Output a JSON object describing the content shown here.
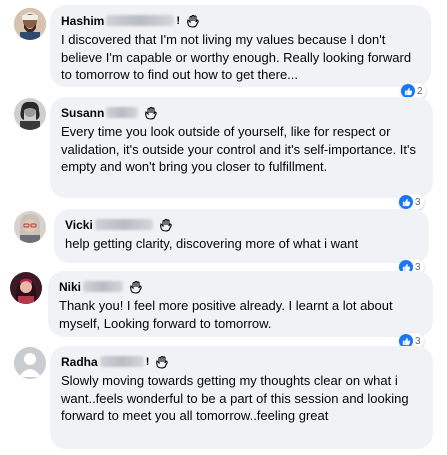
{
  "comments": [
    {
      "name": "Hashim",
      "text": "I discovered that I'm not living my values because I don't believe I'm capable or worthy enough. Really looking forward to tomorrow to find out how to get there...",
      "reactions": "2",
      "avatar_color": "#8a6a55"
    },
    {
      "name": "Susann",
      "text": "Every time you look outside of yourself, like for respect or validation, it's outside your control and it's self-importance. It's empty and won't bring you closer to fulfillment.",
      "reactions": "3",
      "avatar_color": "#6b6b6b"
    },
    {
      "name": "Vicki",
      "text": "help getting clarity, discovering more of what i want",
      "reactions": "3",
      "avatar_color": "#a08b7a"
    },
    {
      "name": "Niki",
      "text": "Thank you! I feel more positive already. I learnt a lot about myself, Looking forward to tomorrow.",
      "reactions": "3",
      "avatar_color": "#7b2c3a"
    },
    {
      "name": "Radha",
      "text": "Slowly moving towards getting my thoughts clear on what i want..feels wonderful to be a part of this session and looking forward to meet you all tomorrow..feeling great",
      "reactions": "",
      "avatar_color": "#c9ccd1"
    }
  ],
  "colors": {
    "bubble": "#f0f2f5",
    "like": "#1877f2",
    "text": "#050505"
  },
  "icons": {
    "badge": "waving-hand-icon",
    "reaction": "thumbs-up-icon"
  }
}
